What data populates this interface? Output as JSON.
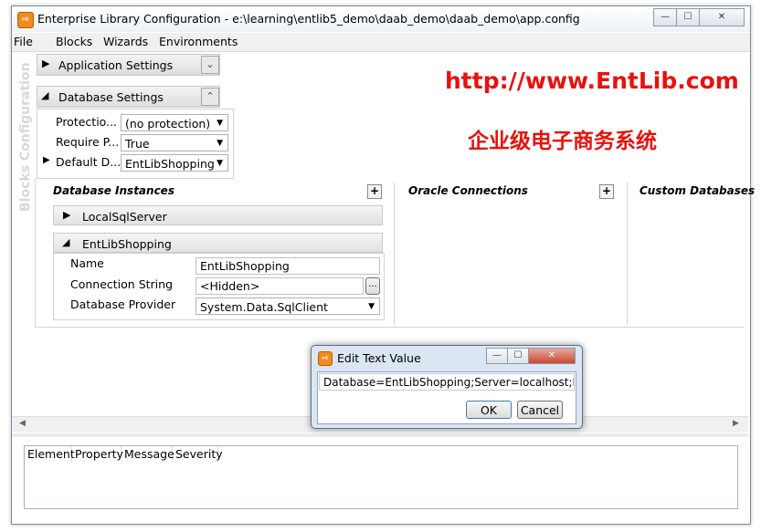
{
  "window": {
    "title": "Enterprise Library Configuration - e:\\learning\\entlib5_demo\\daab_demo\\daab_demo\\app.config",
    "min_glyph": "—",
    "max_glyph": "☐",
    "close_glyph": "✕"
  },
  "menu": [
    "File",
    "Blocks",
    "Wizards",
    "Environments"
  ],
  "vertical_tab": "Blocks Configuration",
  "sections": {
    "application_settings": "Application Settings",
    "database_settings": "Database Settings"
  },
  "db_settings_props": [
    {
      "label": "Protectio...",
      "value": "(no protection)"
    },
    {
      "label": "Require P...",
      "value": "True"
    },
    {
      "label": "Default D...",
      "value": "EntLibShopping"
    }
  ],
  "overlay": {
    "url": "http://www.EntLib.com",
    "chinese": "企业级电子商务系统",
    "color": "#e8120c"
  },
  "columns": {
    "database_instances": "Database Instances",
    "oracle_connections": "Oracle Connections",
    "custom_databases": "Custom Databases"
  },
  "instances": {
    "local": "LocalSqlServer",
    "entlib": "EntLibShopping"
  },
  "instance_props": {
    "name_label": "Name",
    "name_value": "EntLibShopping",
    "conn_label": "Connection String",
    "conn_value": "<Hidden>",
    "provider_label": "Database Provider",
    "provider_value": "System.Data.SqlClient",
    "ellipsis": "..."
  },
  "error_grid": {
    "headers": [
      "Element",
      "Property",
      "Message",
      "Severity"
    ]
  },
  "dialog": {
    "title": "Edit Text Value",
    "text_value": "Database=EntLibShopping;Server=localhost;Integrated Security=SSPI",
    "ok": "OK",
    "cancel": "Cancel"
  }
}
